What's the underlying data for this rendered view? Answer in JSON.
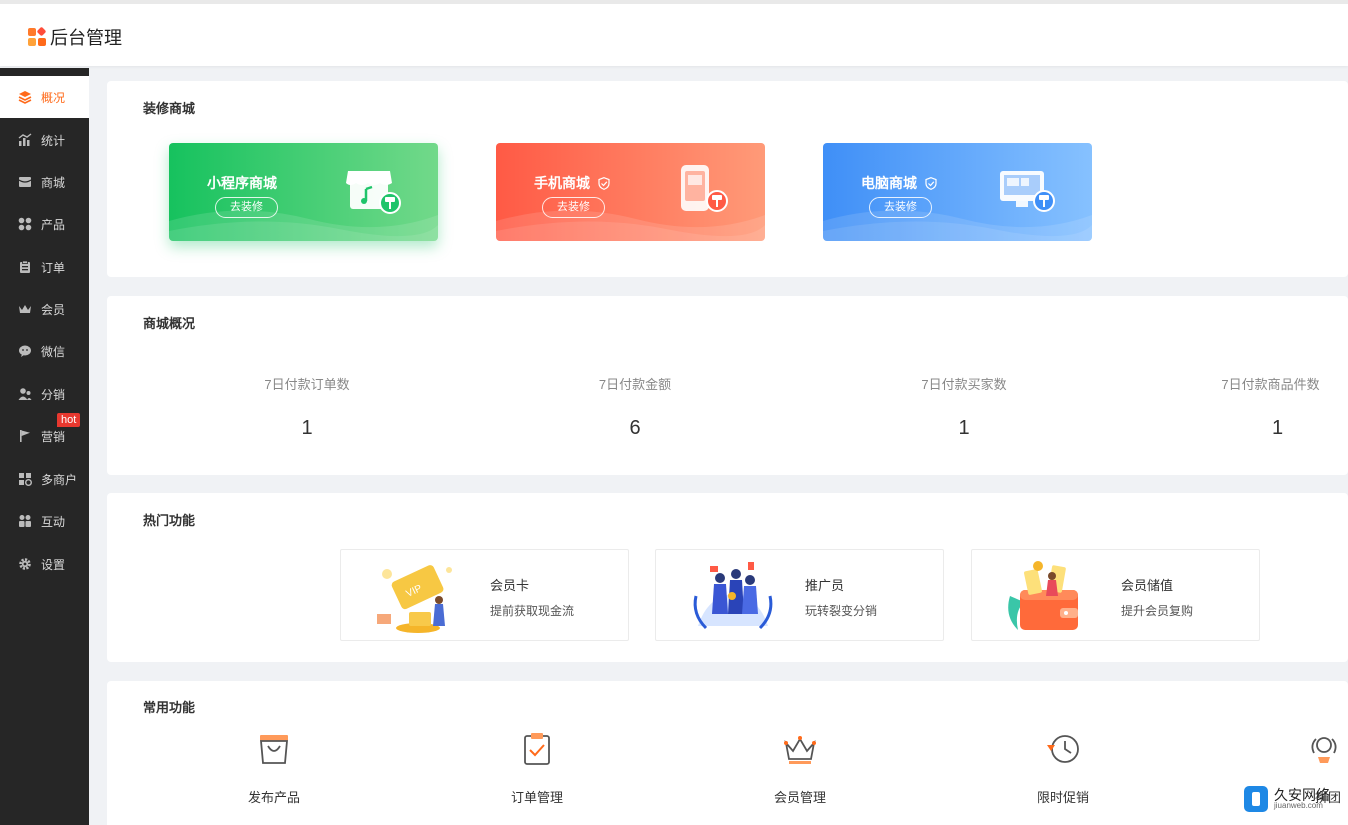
{
  "header": {
    "logo_text": "后台管理"
  },
  "sidebar": {
    "items": [
      {
        "label": "概况",
        "icon": "layers-icon",
        "active": true
      },
      {
        "label": "统计",
        "icon": "chart-icon"
      },
      {
        "label": "商城",
        "icon": "store-icon"
      },
      {
        "label": "产品",
        "icon": "grid-icon"
      },
      {
        "label": "订单",
        "icon": "clipboard-icon"
      },
      {
        "label": "会员",
        "icon": "crown-icon"
      },
      {
        "label": "微信",
        "icon": "wechat-icon"
      },
      {
        "label": "分销",
        "icon": "users-icon"
      },
      {
        "label": "营销",
        "icon": "flag-icon"
      },
      {
        "label": "多商户",
        "icon": "merchant-icon"
      },
      {
        "label": "互动",
        "icon": "interact-icon"
      },
      {
        "label": "设置",
        "icon": "gear-icon"
      }
    ],
    "hot_badge": "hot"
  },
  "decorate": {
    "title": "装修商城",
    "cards": [
      {
        "name": "小程序商城",
        "button": "去装修",
        "color": "#1fc46a",
        "verified": false
      },
      {
        "name": "手机商城",
        "button": "去装修",
        "color": "#ff6a4a",
        "verified": true
      },
      {
        "name": "电脑商城",
        "button": "去装修",
        "color": "#4a9dff",
        "verified": true
      }
    ]
  },
  "overview": {
    "title": "商城概况",
    "stats": [
      {
        "label": "7日付款订单数",
        "value": "1"
      },
      {
        "label": "7日付款金额",
        "value": "6"
      },
      {
        "label": "7日付款买家数",
        "value": "1"
      },
      {
        "label": "7日付款商品件数",
        "value": "1"
      }
    ]
  },
  "hot": {
    "title": "热门功能",
    "cards": [
      {
        "title": "会员卡",
        "desc": "提前获取现金流"
      },
      {
        "title": "推广员",
        "desc": "玩转裂变分销"
      },
      {
        "title": "会员储值",
        "desc": "提升会员复购"
      }
    ]
  },
  "common": {
    "title": "常用功能",
    "items": [
      {
        "label": "发布产品",
        "icon": "shopping-bag-icon"
      },
      {
        "label": "订单管理",
        "icon": "order-check-icon"
      },
      {
        "label": "会员管理",
        "icon": "member-crown-icon"
      },
      {
        "label": "限时促销",
        "icon": "clock-icon"
      },
      {
        "label": "拼团",
        "icon": "group-icon"
      }
    ]
  },
  "watermark": {
    "name": "久安网络",
    "url": "jiuanweb.com"
  }
}
